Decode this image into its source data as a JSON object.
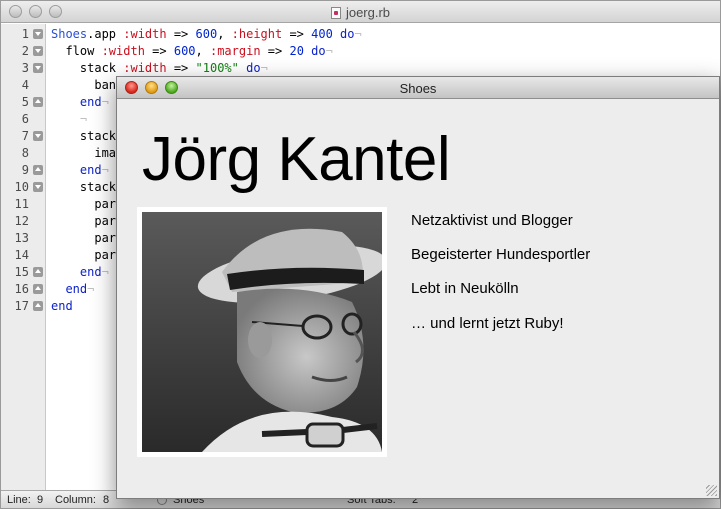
{
  "editor": {
    "title": "joerg.rb",
    "code_lines": [
      {
        "num": "1",
        "fold": "down",
        "tokens": [
          {
            "t": "Shoes",
            "c": "const"
          },
          {
            "t": ".app ",
            "c": "plain"
          },
          {
            "t": ":width",
            "c": "sym"
          },
          {
            "t": " => ",
            "c": "plain"
          },
          {
            "t": "600",
            "c": "num"
          },
          {
            "t": ", ",
            "c": "plain"
          },
          {
            "t": ":height",
            "c": "sym"
          },
          {
            "t": " => ",
            "c": "plain"
          },
          {
            "t": "400",
            "c": "num"
          },
          {
            "t": " do",
            "c": "kw"
          },
          {
            "t": "¬",
            "c": "eol"
          }
        ]
      },
      {
        "num": "2",
        "fold": "down",
        "tokens": [
          {
            "t": "  flow ",
            "c": "plain"
          },
          {
            "t": ":width",
            "c": "sym"
          },
          {
            "t": " => ",
            "c": "plain"
          },
          {
            "t": "600",
            "c": "num"
          },
          {
            "t": ", ",
            "c": "plain"
          },
          {
            "t": ":margin",
            "c": "sym"
          },
          {
            "t": " => ",
            "c": "plain"
          },
          {
            "t": "20",
            "c": "num"
          },
          {
            "t": " do",
            "c": "kw"
          },
          {
            "t": "¬",
            "c": "eol"
          }
        ]
      },
      {
        "num": "3",
        "fold": "down",
        "tokens": [
          {
            "t": "    stack ",
            "c": "plain"
          },
          {
            "t": ":width",
            "c": "sym"
          },
          {
            "t": " => ",
            "c": "plain"
          },
          {
            "t": "\"100%\"",
            "c": "str"
          },
          {
            "t": " do",
            "c": "kw"
          },
          {
            "t": "¬",
            "c": "eol"
          }
        ]
      },
      {
        "num": "4",
        "fold": "",
        "tokens": [
          {
            "t": "      bann",
            "c": "plain"
          }
        ]
      },
      {
        "num": "5",
        "fold": "up",
        "tokens": [
          {
            "t": "    end",
            "c": "kw"
          },
          {
            "t": "¬",
            "c": "eol"
          }
        ]
      },
      {
        "num": "6",
        "fold": "",
        "tokens": [
          {
            "t": "    ",
            "c": "plain"
          },
          {
            "t": "¬",
            "c": "eol"
          }
        ]
      },
      {
        "num": "7",
        "fold": "down",
        "tokens": [
          {
            "t": "    stack",
            "c": "plain"
          }
        ]
      },
      {
        "num": "8",
        "fold": "",
        "tokens": [
          {
            "t": "      imag",
            "c": "plain"
          }
        ]
      },
      {
        "num": "9",
        "fold": "up",
        "tokens": [
          {
            "t": "    end",
            "c": "kw"
          },
          {
            "t": "¬",
            "c": "eol"
          }
        ]
      },
      {
        "num": "10",
        "fold": "down",
        "tokens": [
          {
            "t": "    stack",
            "c": "plain"
          }
        ]
      },
      {
        "num": "11",
        "fold": "",
        "tokens": [
          {
            "t": "      para",
            "c": "plain"
          }
        ]
      },
      {
        "num": "12",
        "fold": "",
        "tokens": [
          {
            "t": "      para",
            "c": "plain"
          }
        ]
      },
      {
        "num": "13",
        "fold": "",
        "tokens": [
          {
            "t": "      para",
            "c": "plain"
          }
        ]
      },
      {
        "num": "14",
        "fold": "",
        "tokens": [
          {
            "t": "      para",
            "c": "plain"
          }
        ]
      },
      {
        "num": "15",
        "fold": "up",
        "tokens": [
          {
            "t": "    end",
            "c": "kw"
          },
          {
            "t": "¬",
            "c": "eol"
          }
        ]
      },
      {
        "num": "16",
        "fold": "up",
        "tokens": [
          {
            "t": "  end",
            "c": "kw"
          },
          {
            "t": "¬",
            "c": "eol"
          }
        ]
      },
      {
        "num": "17",
        "fold": "up",
        "tokens": [
          {
            "t": "end",
            "c": "kw"
          }
        ]
      }
    ],
    "status": {
      "line_label": "Line:",
      "line_value": "9",
      "column_label": "Column:",
      "column_value": "8",
      "language": "Shoes",
      "soft_tabs_label": "Soft Tabs:",
      "soft_tabs_value": "2"
    }
  },
  "shoes_window": {
    "title": "Shoes",
    "banner": "Jörg Kantel",
    "photo_alt": "",
    "paras": [
      "Netzaktivist und Blogger",
      "Begeisterter Hundesportler",
      "Lebt in Neukölln",
      "… und lernt jetzt Ruby!"
    ]
  },
  "colors": {
    "const": "#2b4fcf",
    "symbol": "#c8101e",
    "number": "#0024d0",
    "keyword": "#0d22c8",
    "string": "#108010"
  }
}
